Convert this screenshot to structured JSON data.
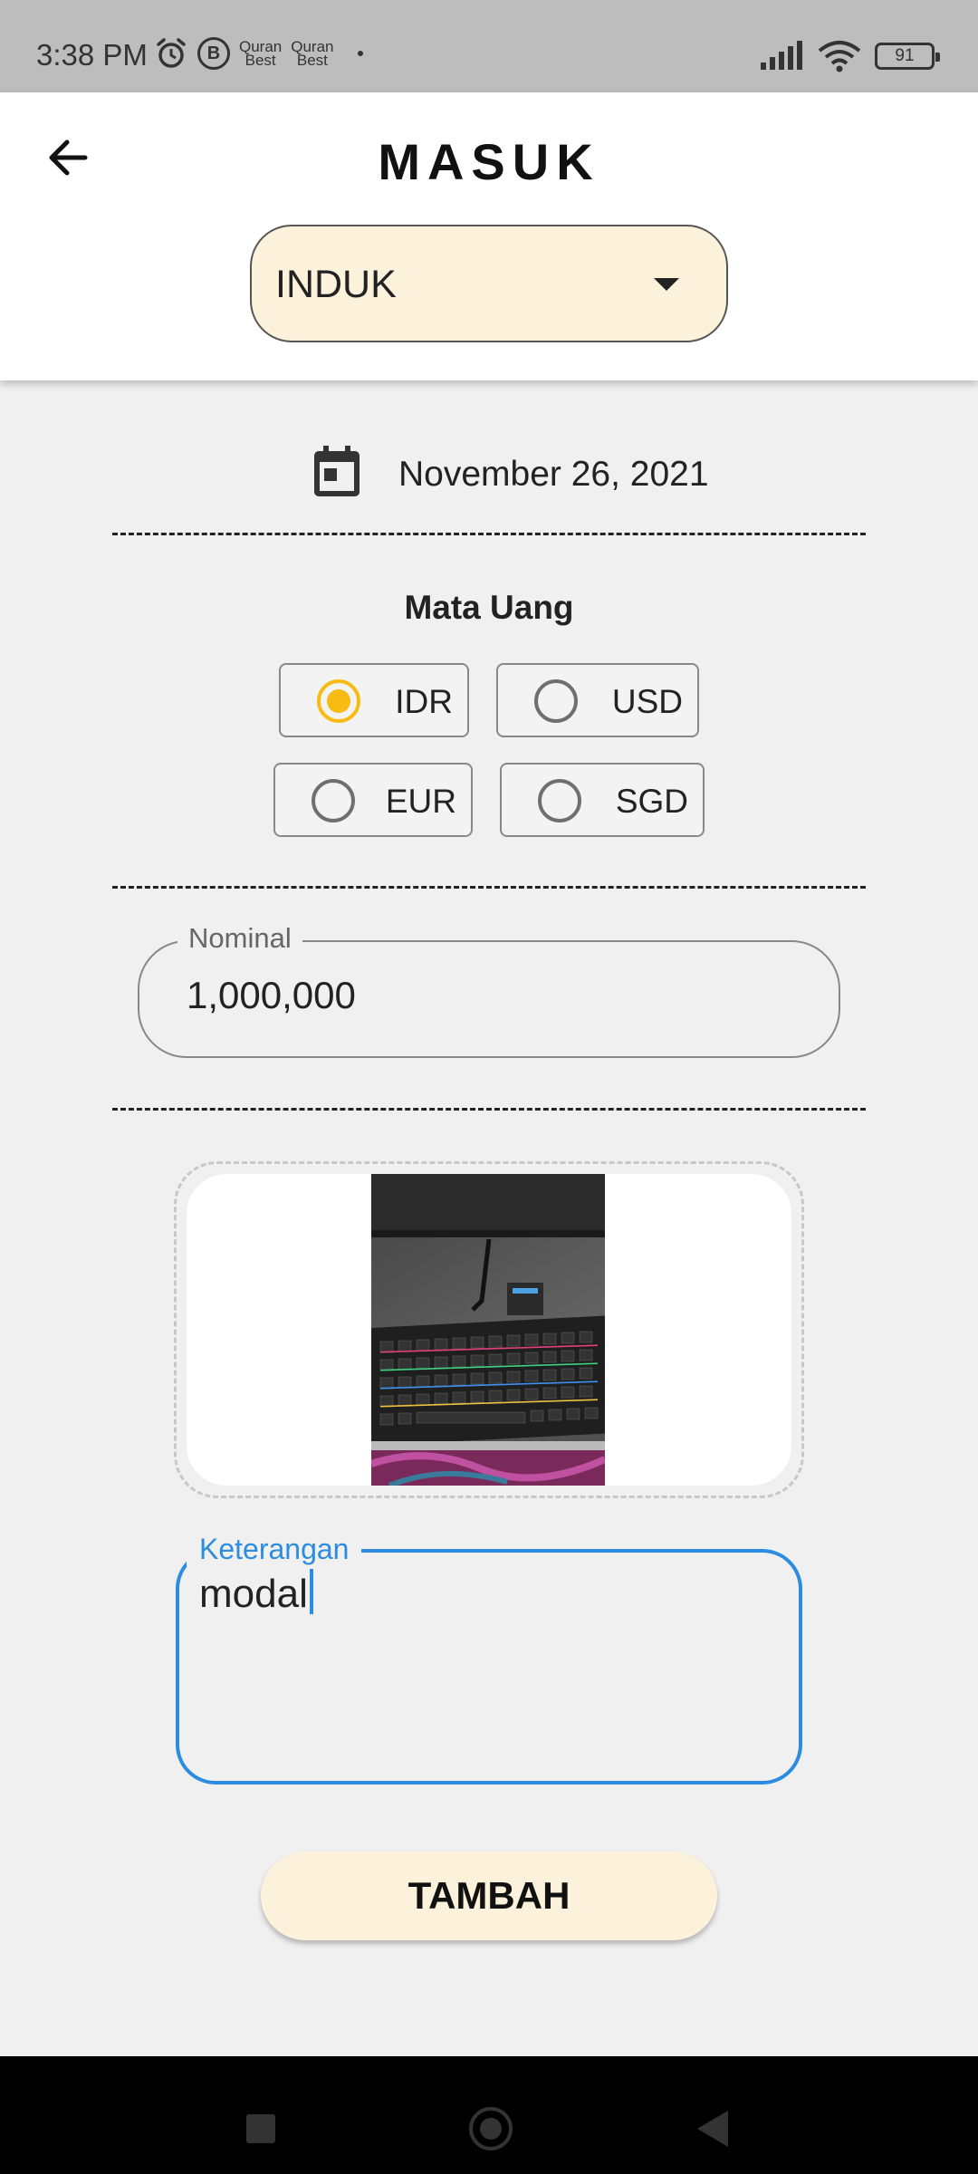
{
  "status": {
    "time": "3:38 PM",
    "app_icon_b": "B",
    "quran_1": "Quran",
    "quran_1_sub": "Best",
    "quran_2": "Quran",
    "quran_2_sub": "Best",
    "battery": "91",
    "icons": [
      "alarm-icon",
      "b-app-icon",
      "quran-icon",
      "quran-icon",
      "signal-icon",
      "wifi-icon",
      "battery-icon"
    ]
  },
  "header": {
    "title": "MASUK",
    "back_icon": "arrow-left-icon",
    "dropdown_value": "INDUK"
  },
  "date": {
    "icon": "calendar-icon",
    "value": "November 26, 2021"
  },
  "currency": {
    "heading": "Mata Uang",
    "options": [
      {
        "label": "IDR",
        "selected": true
      },
      {
        "label": "USD",
        "selected": false
      },
      {
        "label": "EUR",
        "selected": false
      },
      {
        "label": "SGD",
        "selected": false
      }
    ],
    "selected_color": "#F8BB14"
  },
  "nominal": {
    "label": "Nominal",
    "value": "1,000,000"
  },
  "attachment": {
    "image": "keyboard-photo"
  },
  "keterangan": {
    "label": "Keterangan",
    "value": "modal",
    "focus_color": "#2C8DE0"
  },
  "submit": {
    "label": "TAMBAH"
  },
  "colors": {
    "accent_bg": "#FCF1DA",
    "page_bg": "#F0F0F0"
  }
}
